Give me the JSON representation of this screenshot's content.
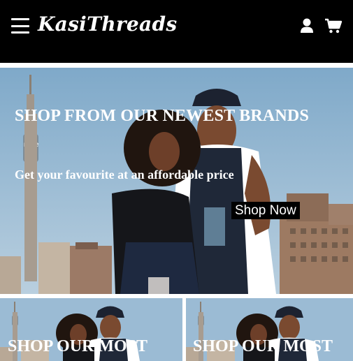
{
  "header": {
    "logo": "KasiThreads",
    "icons": {
      "menu": "hamburger-menu-icon",
      "user": "user-icon",
      "cart": "cart-icon"
    },
    "background": "#000000"
  },
  "hero": {
    "title": "SHOP FROM OUR NEWEST BRANDS",
    "subtitle": "Get your favourite at an affordable price",
    "cta": "Shop Now"
  },
  "cards": [
    {
      "title": "SHOP OUR MOST"
    },
    {
      "title": "SHOP OUR MOST"
    }
  ]
}
